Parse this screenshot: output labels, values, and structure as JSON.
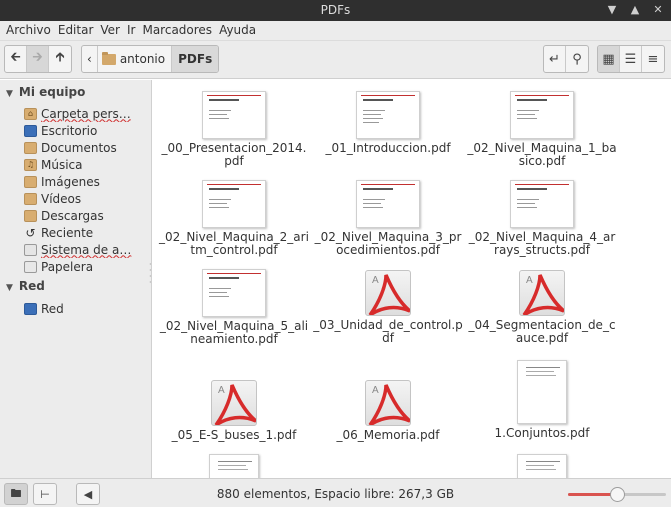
{
  "window": {
    "title": "PDFs"
  },
  "menubar": {
    "items": [
      "Archivo",
      "Editar",
      "Ver",
      "Ir",
      "Marcadores",
      "Ayuda"
    ]
  },
  "breadcrumb": {
    "items": [
      "antonio",
      "PDFs"
    ]
  },
  "sidebar": {
    "sections": [
      {
        "header": "Mi equipo",
        "items": [
          "Carpeta pers…",
          "Escritorio",
          "Documentos",
          "Música",
          "Imágenes",
          "Vídeos",
          "Descargas",
          "Reciente",
          "Sistema de a…",
          "Papelera"
        ]
      },
      {
        "header": "Red",
        "items": [
          "Red"
        ]
      }
    ]
  },
  "files": [
    {
      "name": "_00_Presentacion_2014.pdf",
      "thumb": "slide"
    },
    {
      "name": "_01_Introduccion.pdf",
      "thumb": "slide"
    },
    {
      "name": "_02_Nivel_Maquina_1_basico.pdf",
      "thumb": "slide"
    },
    {
      "name": "_02_Nivel_Maquina_2_aritm_control.pdf",
      "thumb": "slide"
    },
    {
      "name": "_02_Nivel_Maquina_3_procedimientos.pdf",
      "thumb": "slide"
    },
    {
      "name": "_02_Nivel_Maquina_4_arrays_structs.pdf",
      "thumb": "slide"
    },
    {
      "name": "_02_Nivel_Maquina_5_alineamiento.pdf",
      "thumb": "slide"
    },
    {
      "name": "_03_Unidad_de_control.pdf",
      "thumb": "pdf-icon"
    },
    {
      "name": "_04_Segmentacion_de_cauce.pdf",
      "thumb": "pdf-icon"
    },
    {
      "name": "_05_E-S_buses_1.pdf",
      "thumb": "pdf-icon"
    },
    {
      "name": "_06_Memoria.pdf",
      "thumb": "pdf-icon"
    },
    {
      "name": "1.Conjuntos.pdf",
      "thumb": "page"
    },
    {
      "name": "",
      "thumb": "page"
    },
    {
      "name": "",
      "thumb": "page"
    }
  ],
  "statusbar": {
    "text": "880 elementos, Espacio libre: 267,3 GB",
    "zoom_fraction": 0.5
  },
  "colors": {
    "accent": "#d9534f",
    "folder": "#d8ad70"
  }
}
